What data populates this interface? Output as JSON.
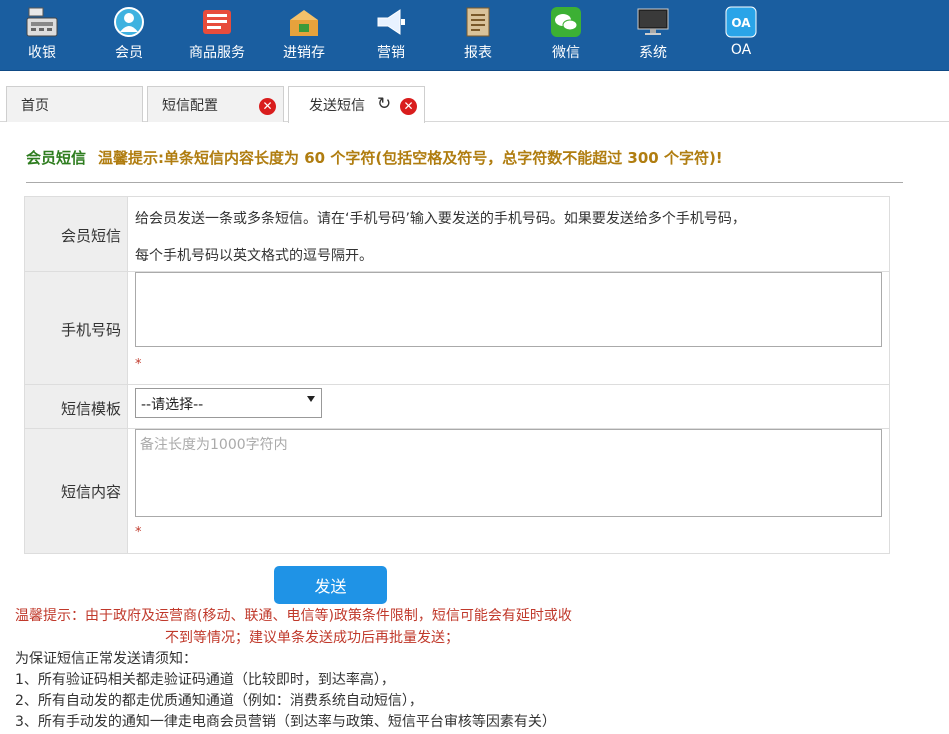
{
  "nav": {
    "items": [
      {
        "label": "收银",
        "icon": "cash-register-icon"
      },
      {
        "label": "会员",
        "icon": "member-icon"
      },
      {
        "label": "商品服务",
        "icon": "goods-icon"
      },
      {
        "label": "进销存",
        "icon": "inventory-icon"
      },
      {
        "label": "营销",
        "icon": "megaphone-icon"
      },
      {
        "label": "报表",
        "icon": "report-icon"
      },
      {
        "label": "微信",
        "icon": "wechat-icon"
      },
      {
        "label": "系统",
        "icon": "monitor-icon"
      },
      {
        "label": "OA",
        "icon": "oa-icon",
        "icon_text": "OA"
      }
    ]
  },
  "tabs": [
    {
      "label": "首页"
    },
    {
      "label": "短信配置"
    },
    {
      "label": "发送短信"
    }
  ],
  "heading": {
    "title": "会员短信",
    "hint": "温馨提示:单条短信内容长度为 60 个字符(包括空格及符号，总字符数不能超过 300 个字符)!"
  },
  "form": {
    "member_sms": {
      "label": "会员短信",
      "desc_line1": "给会员发送一条或多条短信。请在‘手机号码’输入要发送的手机号码。如果要发送给多个手机号码，",
      "desc_line2": "每个手机号码以英文格式的逗号隔开。"
    },
    "phone": {
      "label": "手机号码",
      "value": "",
      "required_mark": "*"
    },
    "template": {
      "label": "短信模板",
      "selected": "--请选择--"
    },
    "content": {
      "label": "短信内容",
      "value": "",
      "placeholder": "备注长度为1000字符内",
      "required_mark": "*"
    }
  },
  "send_button": "发送",
  "warning": {
    "line1": "温馨提示：由于政府及运营商(移动、联通、电信等)政策条件限制，短信可能会有延时或收",
    "line2": "不到等情况；建议单条发送成功后再批量发送；"
  },
  "notes": [
    "为保证短信正常发送请须知：",
    "1、所有验证码相关都走验证码通道（比较即时，到达率高），",
    "2、所有自动发的都走优质通知通道（例如：消费系统自动短信），",
    "3、所有手动发的通知一律走电商会员营销（到达率与政策、短信平台审核等因素有关）"
  ],
  "colors": {
    "nav_bg": "#1a5ea0",
    "accent": "#1f93e6",
    "warning": "#c0392b",
    "hint": "#b07d10",
    "title": "#2e7d1f"
  }
}
